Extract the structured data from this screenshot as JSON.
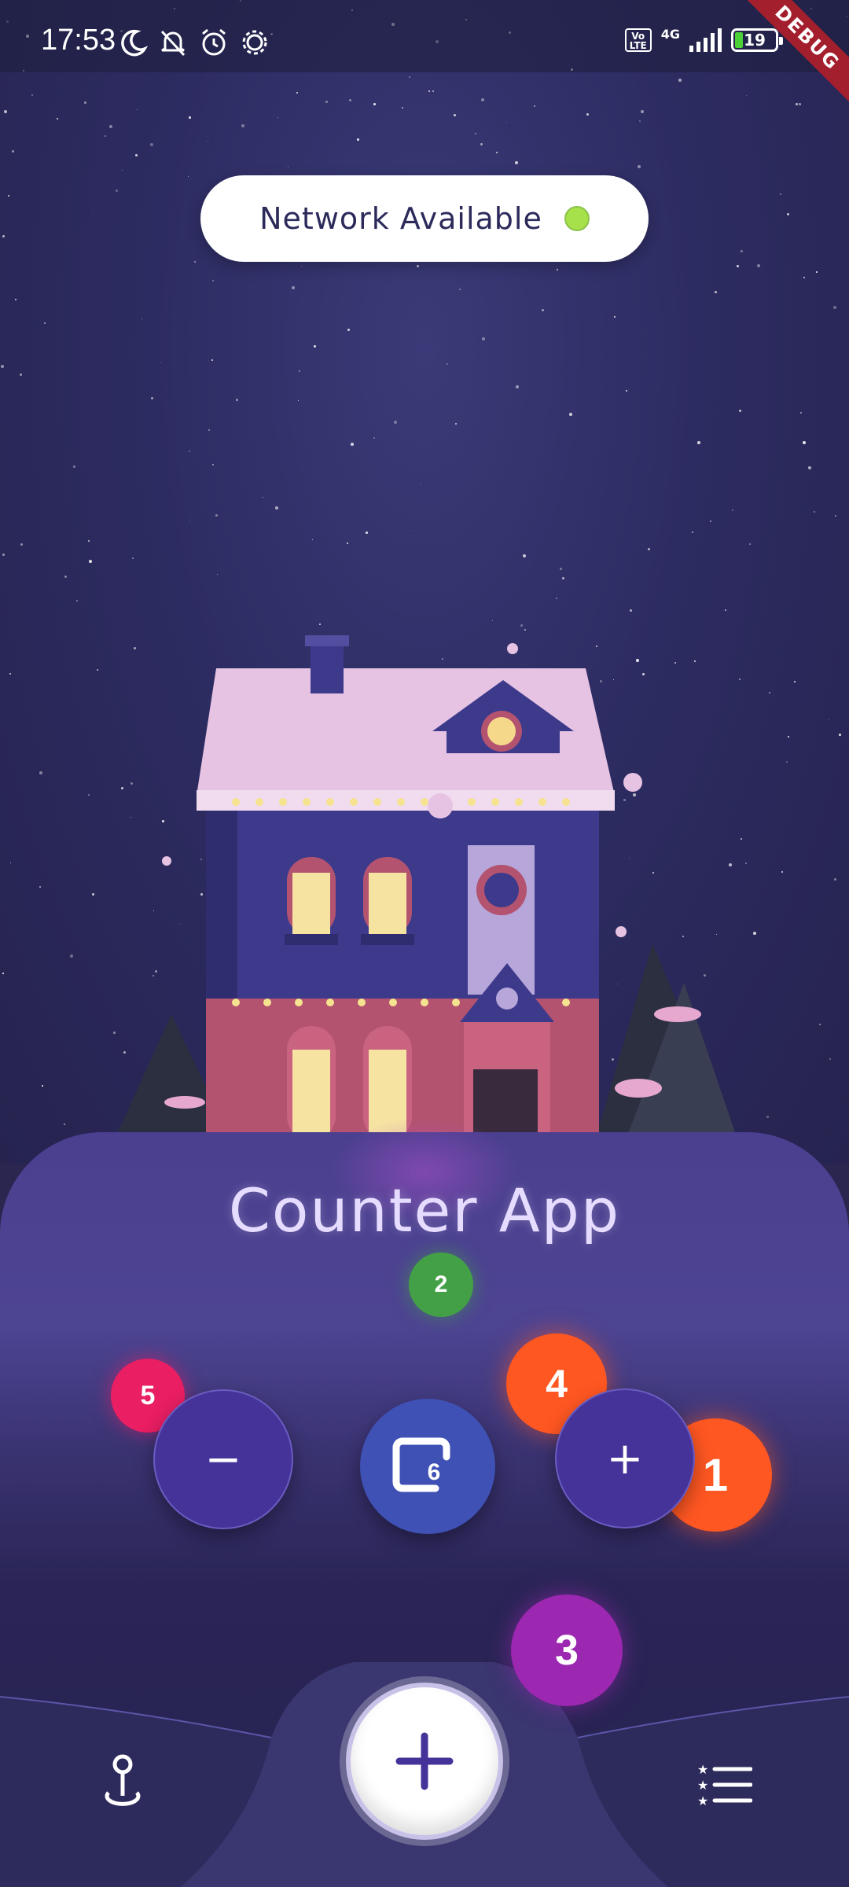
{
  "status_bar": {
    "time": "17:53",
    "network_type": "4G",
    "volte": "Vo LTE",
    "battery_level": "19",
    "debug_label": "DEBUG",
    "icons": [
      "moon-icon",
      "bell-off-icon",
      "alarm-icon",
      "gear-icon"
    ]
  },
  "network_banner": {
    "text": "Network Available",
    "status_color": "#a6e04a"
  },
  "main": {
    "title": "Counter App",
    "counter_value": "6",
    "badges": {
      "one": "1",
      "two": "2",
      "three": "3",
      "four": "4",
      "five": "5"
    },
    "controls": {
      "decrement_label": "−",
      "increment_label": "+"
    }
  },
  "bottom_nav": {
    "left_icon": "location-pin-icon",
    "center_icon": "add-icon",
    "right_icon": "star-list-icon"
  },
  "colors": {
    "accent": "#45339a",
    "counter_button": "#3f51b5",
    "badge_orange": "#ff5722",
    "badge_green": "#43a047",
    "badge_purple": "#9c27b0",
    "badge_pink": "#e91e63"
  }
}
